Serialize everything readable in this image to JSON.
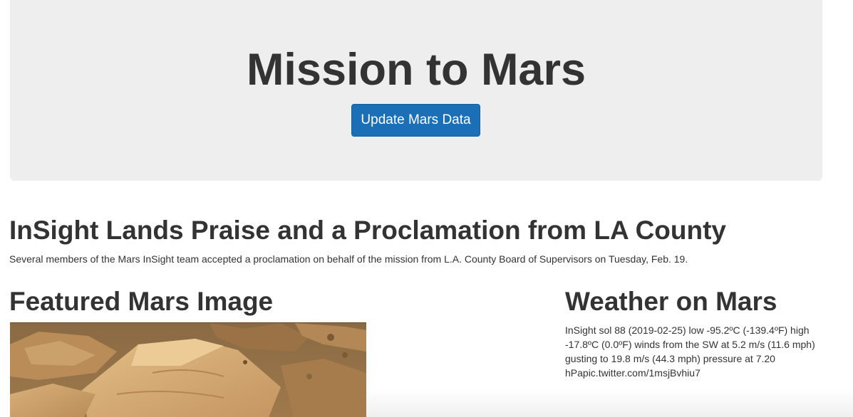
{
  "header": {
    "title": "Mission to Mars",
    "update_button_label": "Update Mars Data"
  },
  "news": {
    "title": "InSight Lands Praise and a Proclamation from LA County",
    "teaser": "Several members of the Mars InSight team accepted a proclamation on behalf of the mission from L.A. County Board of Supervisors on Tuesday, Feb. 19."
  },
  "featured": {
    "heading": "Featured Mars Image"
  },
  "weather": {
    "heading": "Weather on Mars",
    "text": "InSight sol 88 (2019-02-25) low -95.2ºC (-139.4ºF) high -17.8ºC (0.0ºF) winds from the SW at 5.2 m/s (11.6 mph) gusting to 19.8 m/s (44.3 mph) pressure at 7.20 hPapic.twitter.com/1msjBvhiu7"
  },
  "colors": {
    "jumbotron_bg": "#eeeeee",
    "button_bg": "#1a6fb7",
    "text": "#333333"
  }
}
